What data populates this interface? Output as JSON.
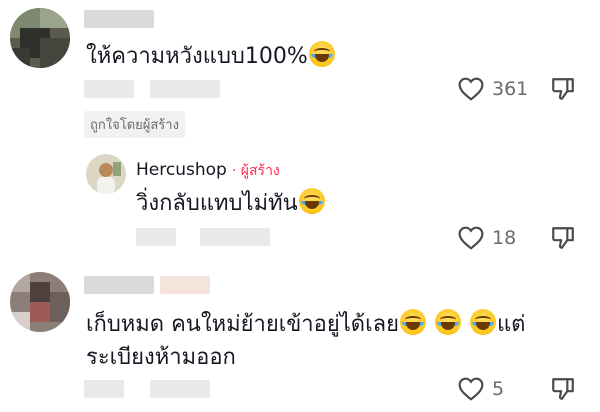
{
  "comments": [
    {
      "text": "ให้ความหวังแบบ100%",
      "likes": "361",
      "badge": "ถูกใจโดยผู้สร้าง"
    },
    {
      "author": "Hercushop",
      "author_tag": "· ผู้สร้าง",
      "text": "วิ่งกลับแทบไม่ทัน",
      "likes": "18"
    },
    {
      "text_line1": "เก็บหมด คนใหม่ย้ายเข้าอยู่ได้เลย",
      "text_line1_end": "แต่",
      "text_line2": "ระเบียงห้ามออก",
      "likes": "5"
    }
  ],
  "icons": {
    "like": "heart-outline-icon",
    "dislike": "thumbs-down-outline-icon",
    "emoji": "face-with-tears-of-joy-emoji"
  },
  "colors": {
    "creator_accent": "#fe2c55",
    "muted_text": "#6b6b6b"
  }
}
